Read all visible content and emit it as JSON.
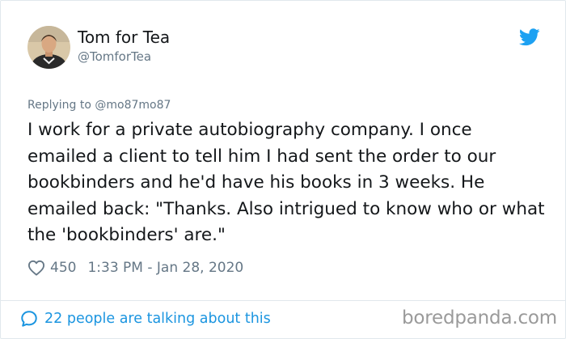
{
  "author": {
    "display_name": "Tom for Tea",
    "handle": "@TomforTea"
  },
  "icons": {
    "brand": "twitter-bird-icon",
    "like": "heart-icon",
    "conversation": "speech-bubble-icon"
  },
  "colors": {
    "brand": "#1da1f2",
    "link": "#1b95e0",
    "secondary_text": "#657786"
  },
  "tweet": {
    "replying_to": "Replying to @mo87mo87",
    "text": "I work for a private autobiography company. I once emailed a client to tell him I had sent the order to our bookbinders and he'd have his books in 3 weeks. He emailed back: \"Thanks. Also intrigued to know who or what the 'bookbinders' are.\"",
    "likes": "450",
    "timestamp": "1:33 PM - Jan 28, 2020"
  },
  "footer": {
    "conversation_label": "22 people are talking about this"
  },
  "watermark": "boredpanda.com"
}
